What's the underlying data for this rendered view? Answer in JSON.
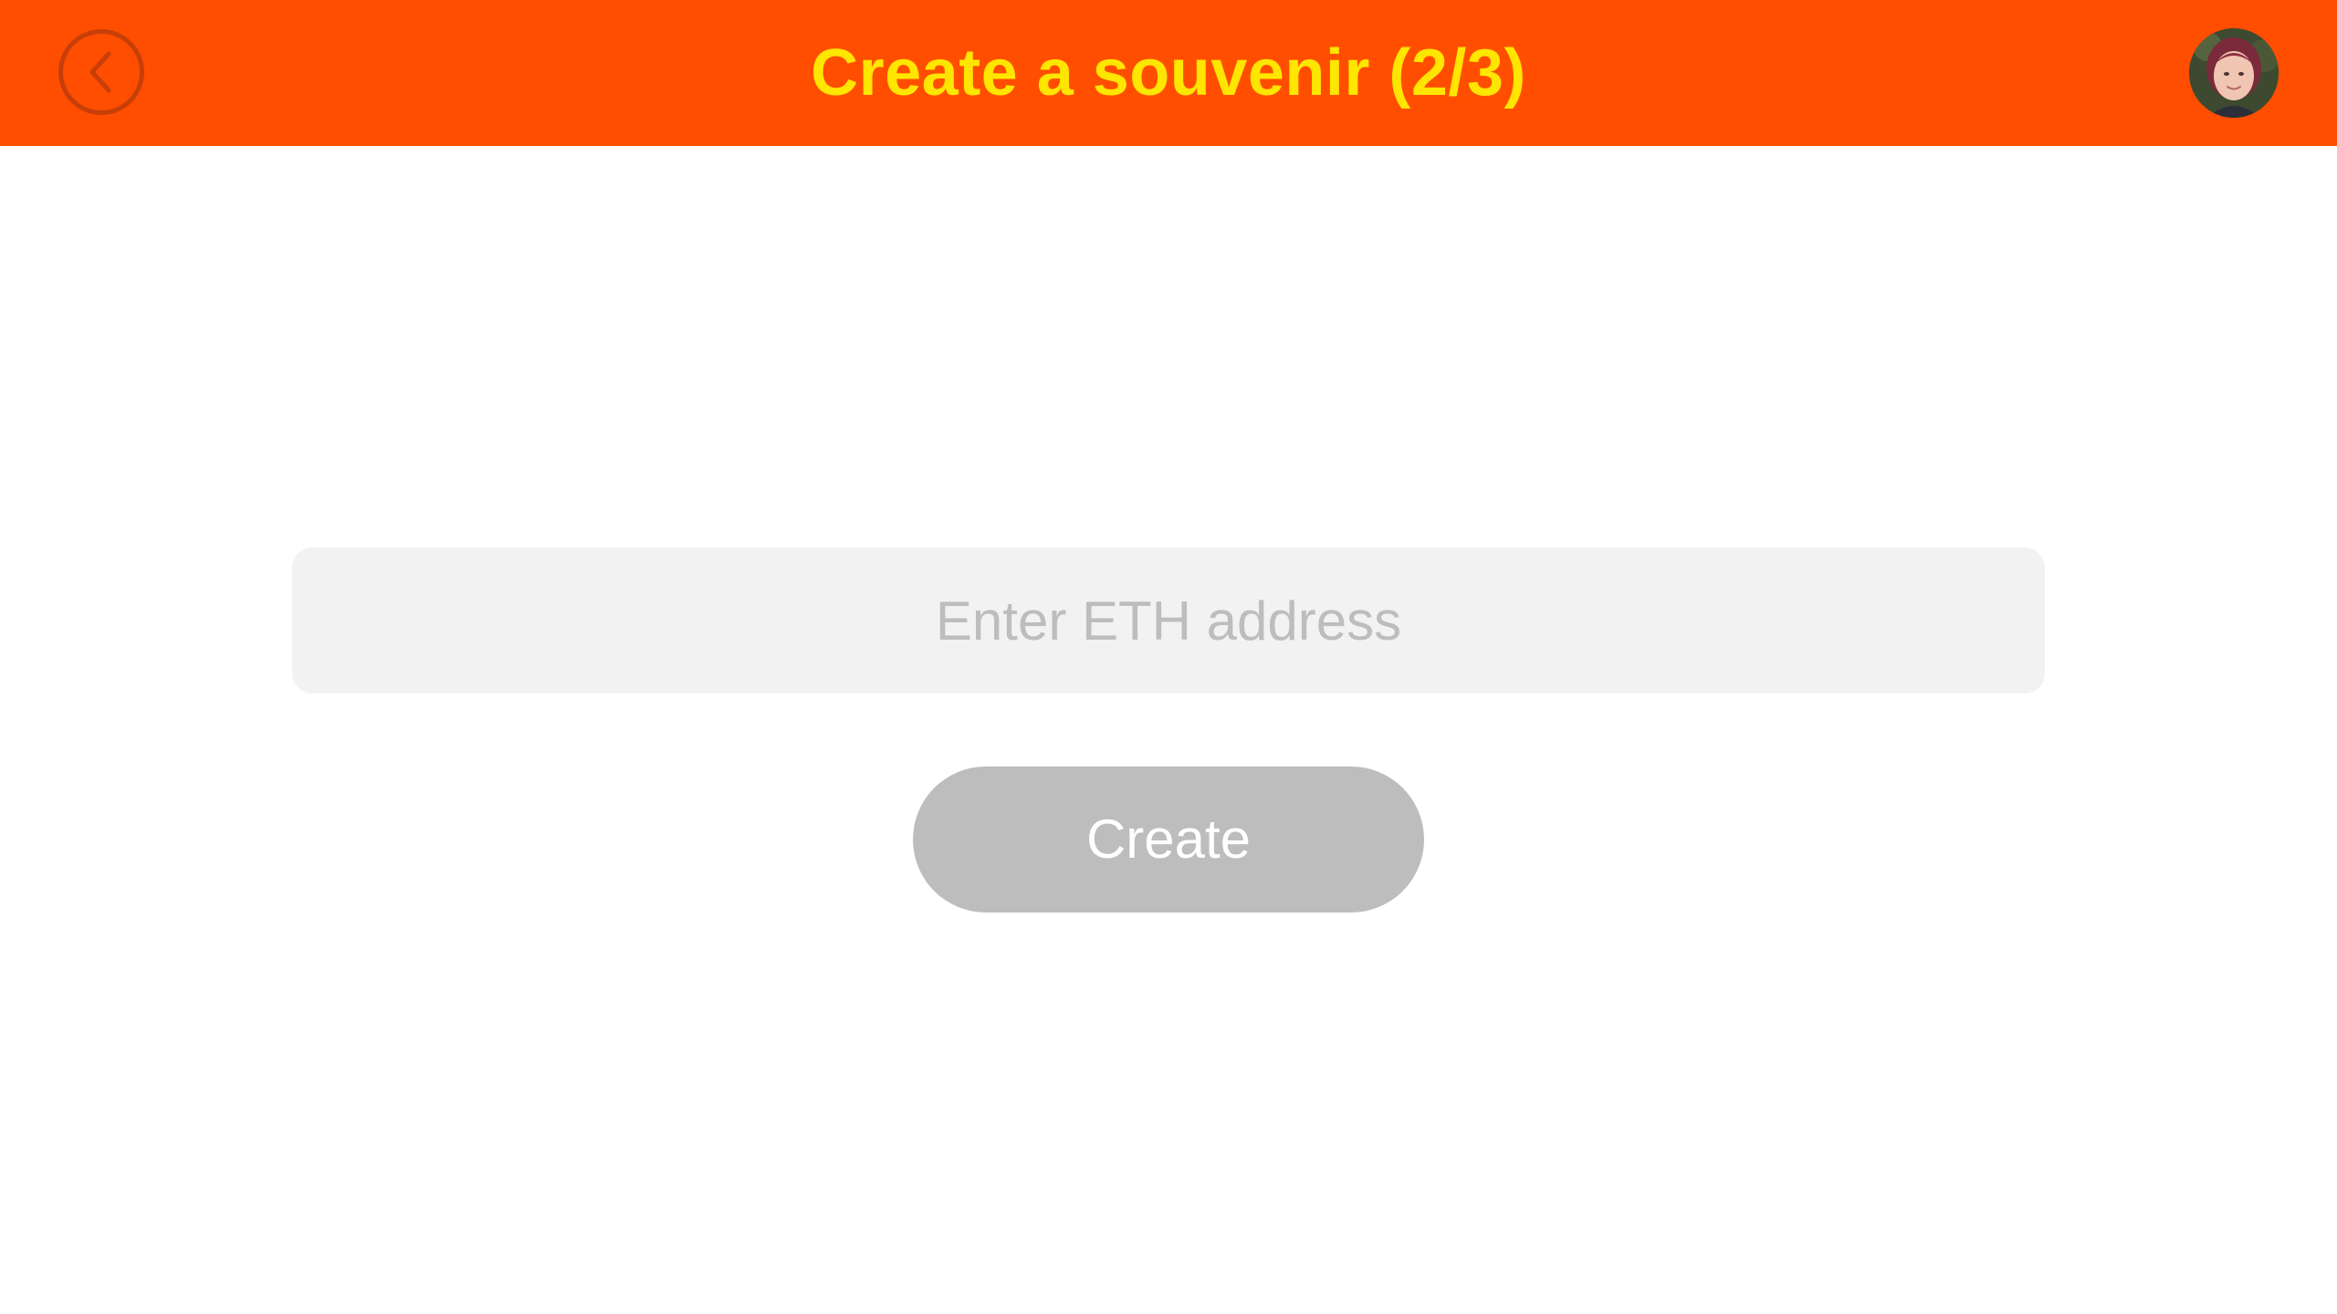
{
  "header": {
    "title": "Create a souvenir (2/3)",
    "background_color": "#FF4E00",
    "title_color": "#FFE600",
    "back_icon": "chevron-left-circle-icon",
    "avatar_icon": "user-avatar"
  },
  "form": {
    "eth_address_placeholder": "Enter ETH address",
    "eth_address_value": "",
    "create_label": "Create",
    "create_button_color": "#BDBDBD"
  }
}
